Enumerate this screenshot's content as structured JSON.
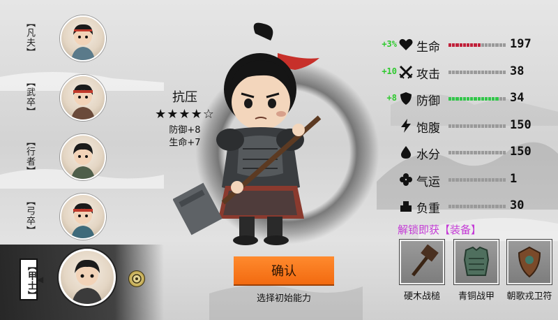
{
  "classes": [
    {
      "label": "【凡夫】",
      "selected": false
    },
    {
      "label": "【武卒】",
      "selected": false
    },
    {
      "label": "【行者】",
      "selected": false
    },
    {
      "label": "【弓卒】",
      "selected": false
    },
    {
      "label": "【甲士】",
      "selected": true
    }
  ],
  "trait": {
    "name": "抗压",
    "stars": "★★★★☆",
    "rating": 4,
    "rating_max": 5,
    "bonuses": [
      "防御+8",
      "生命+7"
    ]
  },
  "confirm": {
    "label": "确认",
    "subtitle": "选择初始能力"
  },
  "stats": [
    {
      "bonus": "+3%",
      "icon": "heart-icon",
      "label": "生命",
      "value": "197",
      "fill": 0.55,
      "fill_color": "#c0213a"
    },
    {
      "bonus": "+10",
      "icon": "crossed-swords-icon",
      "label": "攻击",
      "value": "38",
      "fill": 0.0,
      "fill_color": "#9a9a9a"
    },
    {
      "bonus": "+8",
      "icon": "shield-icon",
      "label": "防御",
      "value": "34",
      "fill": 0.85,
      "fill_color": "#32c64a"
    },
    {
      "bonus": "",
      "icon": "lightning-icon",
      "label": "饱腹",
      "value": "150",
      "fill": 0.0,
      "fill_color": "#9a9a9a"
    },
    {
      "bonus": "",
      "icon": "water-drop-icon",
      "label": "水分",
      "value": "150",
      "fill": 0.0,
      "fill_color": "#9a9a9a"
    },
    {
      "bonus": "",
      "icon": "clover-icon",
      "label": "气运",
      "value": "1",
      "fill": 0.0,
      "fill_color": "#9a9a9a"
    },
    {
      "bonus": "",
      "icon": "weight-icon",
      "label": "负重",
      "value": "30",
      "fill": 0.0,
      "fill_color": "#9a9a9a"
    }
  ],
  "unlock_title": "解锁即获【装备】",
  "equipment": [
    {
      "name": "硬木战槌",
      "icon": "wooden-mallet-icon"
    },
    {
      "name": "青铜战甲",
      "icon": "bronze-armor-icon"
    },
    {
      "name": "朝歌戎卫符",
      "icon": "shield-talisman-icon"
    }
  ],
  "colors": {
    "confirm_button": "#f26a10",
    "bonus_green": "#2ec92e",
    "unlock_purple": "#c43bd6"
  }
}
